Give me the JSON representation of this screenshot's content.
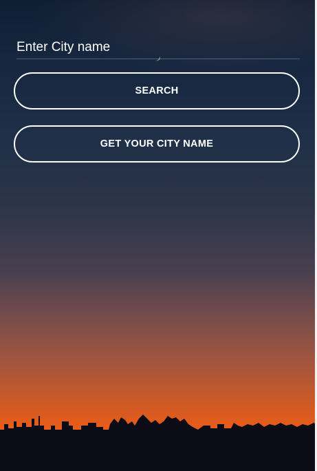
{
  "search": {
    "placeholder": "Enter City name",
    "value": ""
  },
  "buttons": {
    "search_label": "SEARCH",
    "get_city_label": "GET YOUR CITY NAME"
  },
  "colors": {
    "button_border": "#ffffff",
    "text": "#ffffff",
    "sky_top": "#0f1e33",
    "sky_bottom": "#f0621a"
  },
  "background": {
    "image": "sunset-sky-with-crescent-moon-and-city-skyline"
  }
}
